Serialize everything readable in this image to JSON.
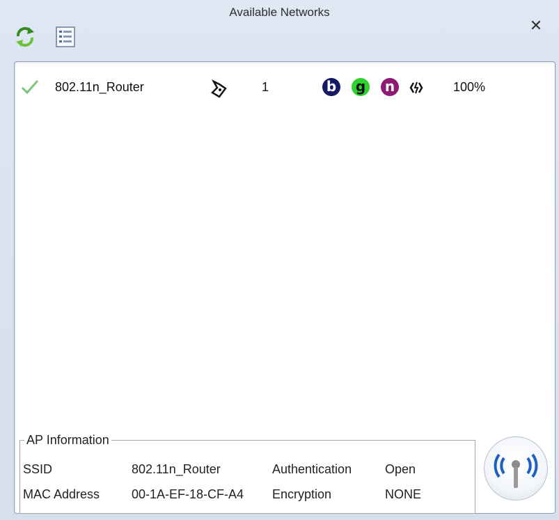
{
  "window": {
    "title": "Available Networks"
  },
  "toolbar": {
    "refresh_icon": "refresh-icon",
    "list_icon": "list-view-icon",
    "close_glyph": "✕"
  },
  "networks": [
    {
      "status_icon": "connected-check-icon",
      "ssid": "802.11n_Router",
      "security_icon": "infrastructure-icon",
      "channel": "1",
      "modes": [
        "b",
        "g",
        "n"
      ],
      "mode_colors": {
        "b": "#141a66",
        "g": "#2fd12f",
        "n": "#8f1a74"
      },
      "transfer_icon": "data-transfer-icon",
      "signal": "100%"
    }
  ],
  "ap_info": {
    "legend": "AP Information",
    "ssid_label": "SSID",
    "ssid_value": "802.11n_Router",
    "auth_label": "Authentication",
    "auth_value": "Open",
    "mac_label": "MAC Address",
    "mac_value": "00-1A-EF-18-CF-A4",
    "enc_label": "Encryption",
    "enc_value": "NONE"
  },
  "connect_button": {
    "icon": "wireless-antenna-icon"
  }
}
